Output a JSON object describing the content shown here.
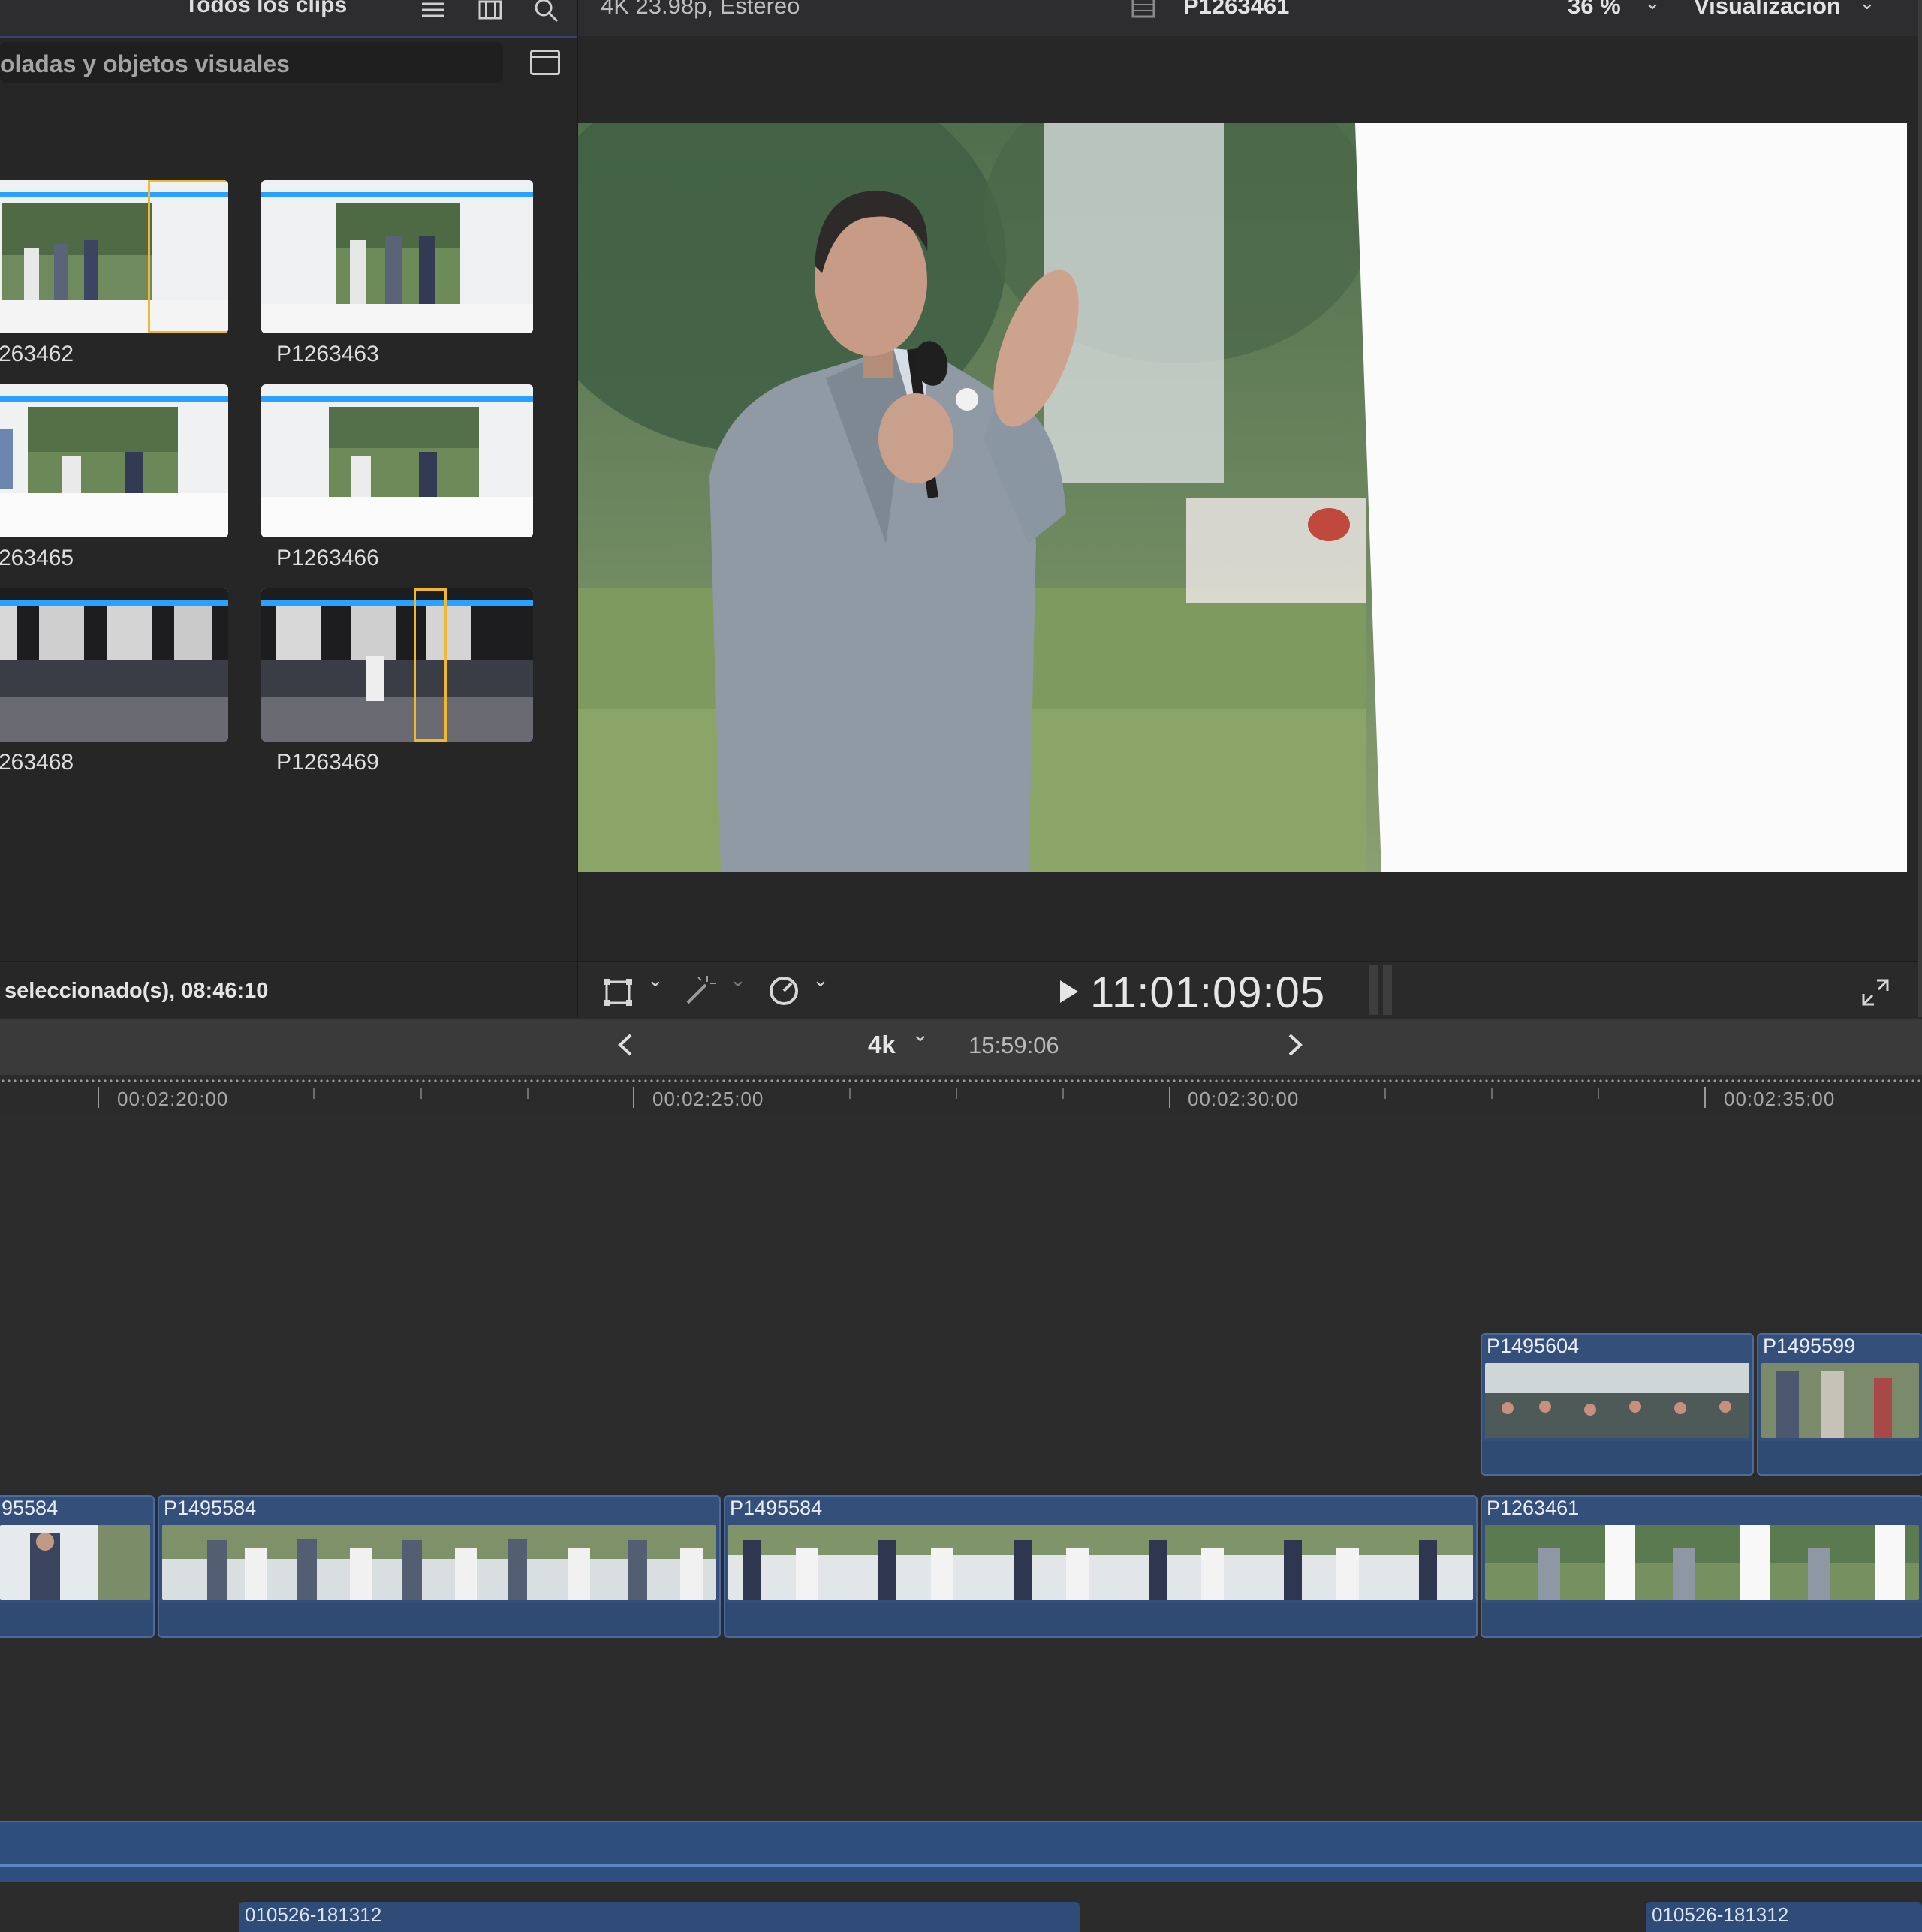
{
  "browser": {
    "filter_label": "Todos los clips",
    "search_placeholder": "oladas y objetos visuales",
    "thumbnails": [
      {
        "label": "263462"
      },
      {
        "label": "P1263463"
      },
      {
        "label": "263465"
      },
      {
        "label": "P1263466"
      },
      {
        "label": "263468"
      },
      {
        "label": "P1263469"
      }
    ],
    "status": "seleccionado(s), 08:46:10"
  },
  "viewer": {
    "format": "4K 23.98p, Estéreo",
    "clip_name": "P1263461",
    "zoom": "36 %",
    "view_menu": "Visualización",
    "timecode": "11:01:09:05"
  },
  "timeline": {
    "project_name": "4k",
    "project_duration": "15:59:06",
    "ruler_labels": [
      "00:02:20:00",
      "00:02:25:00",
      "00:02:30:00",
      "00:02:35:00"
    ],
    "connected_clips": [
      {
        "label": "P1495604"
      },
      {
        "label": "P1495599"
      }
    ],
    "primary_clips": [
      {
        "label": "95584"
      },
      {
        "label": "P1495584"
      },
      {
        "label": "P1495584"
      },
      {
        "label": "P1263461"
      }
    ],
    "audio_clips": [
      {
        "label": "010526-181312"
      },
      {
        "label": "010526-181312"
      }
    ]
  },
  "colors": {
    "accent_blue": "#2aa0ff",
    "selection_yellow": "#f0b733",
    "clip_blue": "#34507a"
  },
  "icons": [
    "list-view-icon",
    "filmstrip-icon",
    "search-icon",
    "sidebar-toggle-icon",
    "transform-icon",
    "magic-wand-icon",
    "speed-icon",
    "play-icon",
    "fullscreen-icon",
    "chevron-left-icon",
    "chevron-right-icon"
  ]
}
